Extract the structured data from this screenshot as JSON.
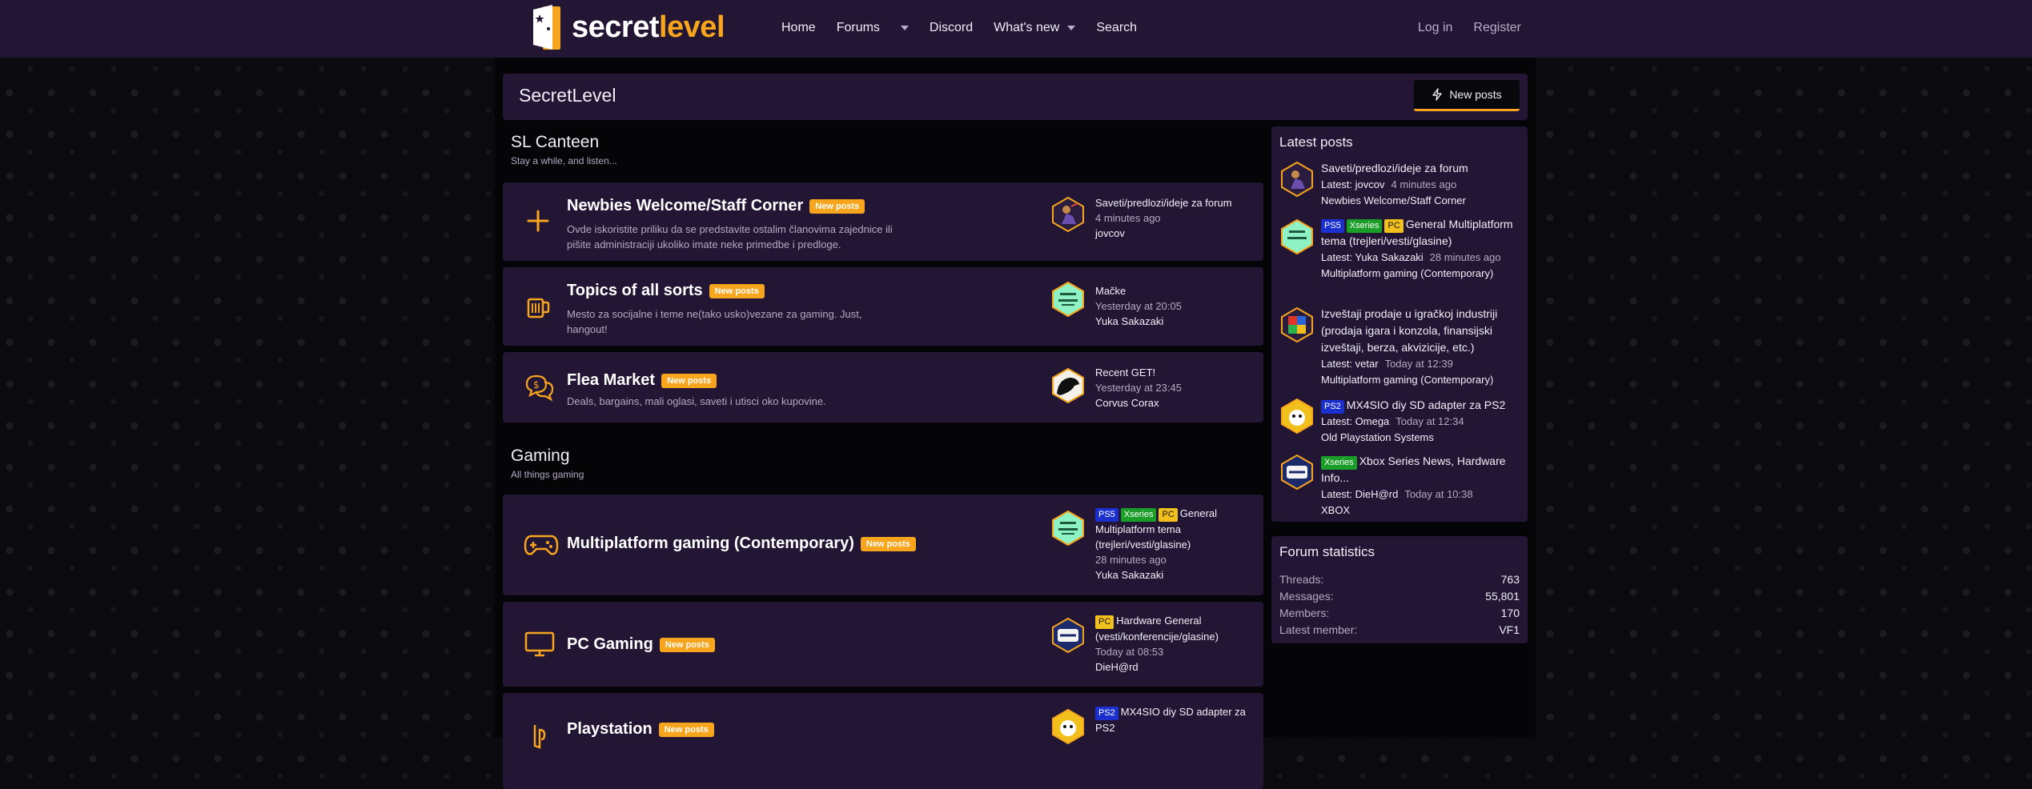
{
  "brand": {
    "logo_white": "secret",
    "logo_orange": "level",
    "accent_color": "#f7a51c",
    "header_color": "#221634"
  },
  "nav": {
    "home": "Home",
    "forums": "Forums",
    "discord": "Discord",
    "whats_new": "What's new",
    "search": "Search",
    "login": "Log in",
    "register": "Register"
  },
  "page": {
    "title": "SecretLevel",
    "new_posts_button": "New posts"
  },
  "categories": [
    {
      "title": "SL Canteen",
      "description": "Stay a while, and listen...",
      "nodes": [
        {
          "icon": "plus-icon",
          "title": "Newbies Welcome/Staff Corner",
          "badge": "New posts",
          "description": "Ovde iskoristite priliku da se predstavite ostalim članovima zajednice ili pišite administraciji ukoliko imate neke primedbe i predloge.",
          "last_title": "Saveti/predlozi/ideje za forum",
          "last_date": "4 minutes ago",
          "last_user": "jovcov"
        },
        {
          "icon": "mug-icon",
          "title": "Topics of all sorts",
          "badge": "New posts",
          "description": "Mesto za socijalne i teme ne(tako usko)vezane za gaming. Just, hangout!",
          "last_title": "Mačke",
          "last_date": "Yesterday at 20:05",
          "last_user": "Yuka Sakazaki"
        },
        {
          "icon": "money-chat-icon",
          "title": "Flea Market",
          "badge": "New posts",
          "description": "Deals, bargains, mali oglasi, saveti i utisci oko kupovine.",
          "last_title": "Recent GET!",
          "last_date": "Yesterday at 23:45",
          "last_user": "Corvus Corax"
        }
      ]
    },
    {
      "title": "Gaming",
      "description": "All things gaming",
      "nodes": [
        {
          "icon": "gamepad-icon",
          "title": "Multiplatform gaming (Contemporary)",
          "badge": "New posts",
          "description": "",
          "last_prefixes": [
            "PS5",
            "Xseries",
            "PC"
          ],
          "last_title": "General Multiplatform tema (trejleri/vesti/glasine)",
          "last_date": "28 minutes ago",
          "last_user": "Yuka Sakazaki"
        },
        {
          "icon": "monitor-icon",
          "title": "PC Gaming",
          "badge": "New posts",
          "description": "",
          "last_prefixes": [
            "PC"
          ],
          "last_title": "Hardware General (vesti/konferencije/glasine)",
          "last_date": "Today at 08:53",
          "last_user": "DieH@rd"
        },
        {
          "icon": "playstation-icon",
          "title": "Playstation",
          "badge": "New posts",
          "description": "",
          "last_prefixes": [
            "PS2"
          ],
          "last_title": "MX4SIO diy SD adapter za PS2",
          "last_date": "",
          "last_user": ""
        }
      ]
    }
  ],
  "latest_posts": {
    "title": "Latest posts",
    "latest_label": "Latest:",
    "items": [
      {
        "prefixes": [],
        "title": "Saveti/predlozi/ideje za forum",
        "user": "jovcov",
        "date": "4 minutes ago",
        "forum": "Newbies Welcome/Staff Corner"
      },
      {
        "prefixes": [
          "PS5",
          "Xseries",
          "PC"
        ],
        "title": "General Multiplatform tema (trejleri/vesti/glasine)",
        "user": "Yuka Sakazaki",
        "date": "28 minutes ago",
        "forum": "Multiplatform gaming (Contemporary)"
      },
      {
        "prefixes": [],
        "title": "Izveštaji prodaje u igračkoj industriji (prodaja igara i konzola, finansijski izveštaji, berza, akvizicije, etc.)",
        "user": "vetar",
        "date": "Today at 12:39",
        "forum": "Multiplatform gaming (Contemporary)"
      },
      {
        "prefixes": [
          "PS2"
        ],
        "title": "MX4SIO diy SD adapter za PS2",
        "user": "Omega",
        "date": "Today at 12:34",
        "forum": "Old Playstation Systems"
      },
      {
        "prefixes": [
          "Xseries"
        ],
        "title": "Xbox Series News, Hardware Info...",
        "user": "DieH@rd",
        "date": "Today at 10:38",
        "forum": "XBOX"
      }
    ]
  },
  "forum_statistics": {
    "title": "Forum statistics",
    "rows": [
      {
        "label": "Threads:",
        "value": "763"
      },
      {
        "label": "Messages:",
        "value": "55,801"
      },
      {
        "label": "Members:",
        "value": "170"
      },
      {
        "label": "Latest member:",
        "value": "VF1"
      }
    ]
  }
}
